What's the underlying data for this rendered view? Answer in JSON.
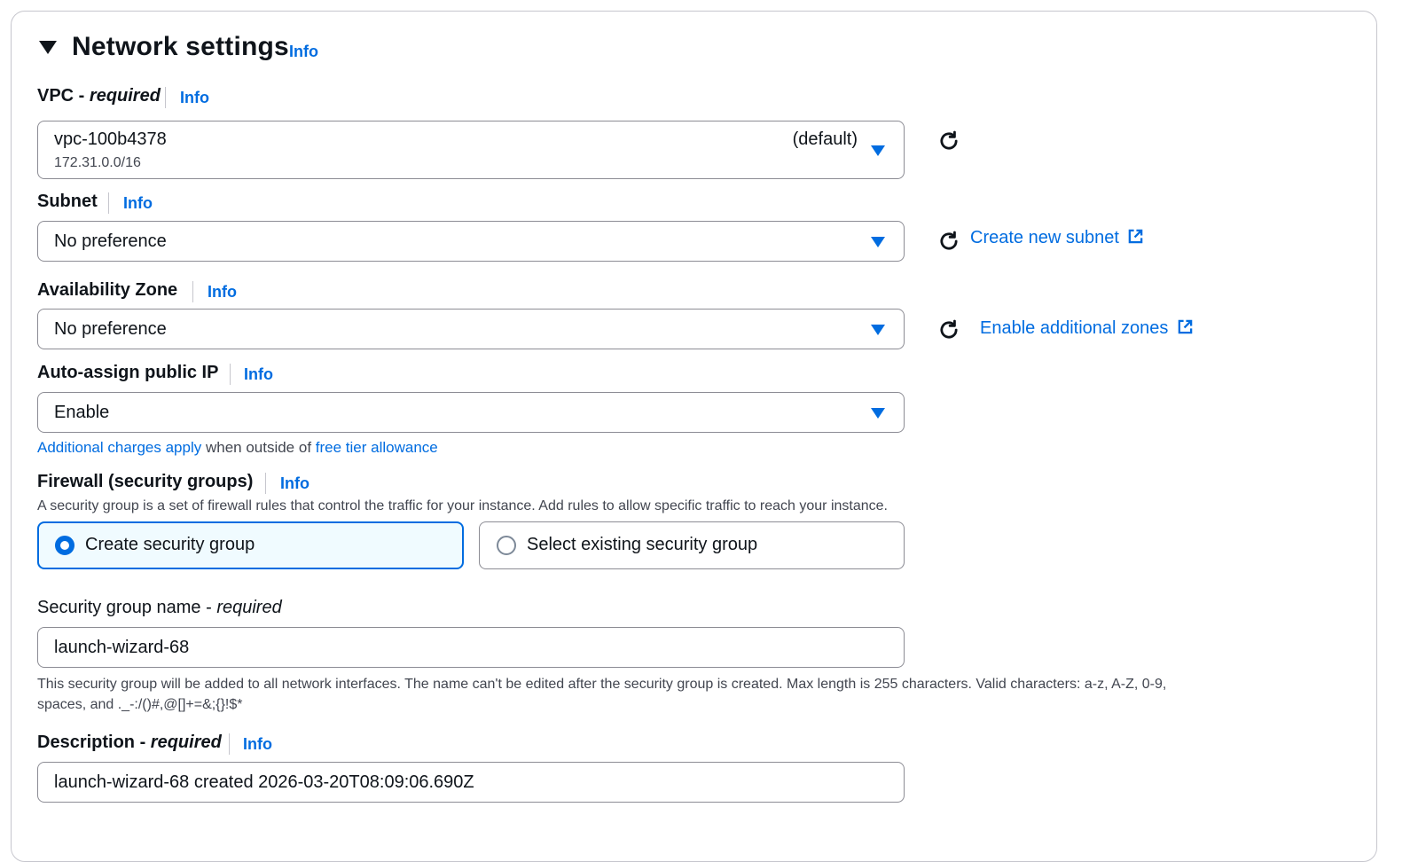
{
  "section": {
    "title": "Network settings",
    "info": "Info"
  },
  "vpc": {
    "label": "VPC - ",
    "label_required": "required",
    "info": "Info",
    "value": "vpc-100b4378",
    "cidr": "172.31.0.0/16",
    "tag": "(default)"
  },
  "subnet": {
    "label": "Subnet",
    "info": "Info",
    "value": "No preference",
    "link": "Create new subnet"
  },
  "availability_zone": {
    "label": "Availability Zone",
    "info": "Info",
    "value": "No preference",
    "link": "Enable additional zones"
  },
  "public_ip": {
    "label": "Auto-assign public IP",
    "info": "Info",
    "value": "Enable",
    "note_link1": "Additional charges apply",
    "note_mid": " when outside of ",
    "note_link2": "free tier allowance"
  },
  "firewall": {
    "label": "Firewall (security groups)",
    "info": "Info",
    "description": "A security group is a set of firewall rules that control the traffic for your instance. Add rules to allow specific traffic to reach your instance.",
    "options": [
      {
        "label": "Create security group",
        "selected": true
      },
      {
        "label": "Select existing security group",
        "selected": false
      }
    ]
  },
  "sg_name": {
    "label": "Security group name - ",
    "label_required": "required",
    "value": "launch-wizard-68",
    "help_line1": "This security group will be added to all network interfaces. The name can't be edited after the security group is created. Max length is 255 characters. Valid characters: a-z, A-Z, 0-9,",
    "help_line2": "spaces, and ._-:/()#,@[]+=&;{}!$*"
  },
  "sg_description": {
    "label": "Description - ",
    "label_required": "required",
    "info": "Info",
    "value": "launch-wizard-68 created 2026-03-20T08:09:06.690Z"
  },
  "colors": {
    "accent": "#006ce0",
    "text": "#0f141a",
    "muted": "#424650",
    "border": "#8c8c94",
    "selected_bg": "#f0fbff"
  },
  "icons": {
    "collapse": "caret-down-icon",
    "dropdown": "triangle-down-icon",
    "refresh": "refresh-icon",
    "external": "external-link-icon"
  }
}
